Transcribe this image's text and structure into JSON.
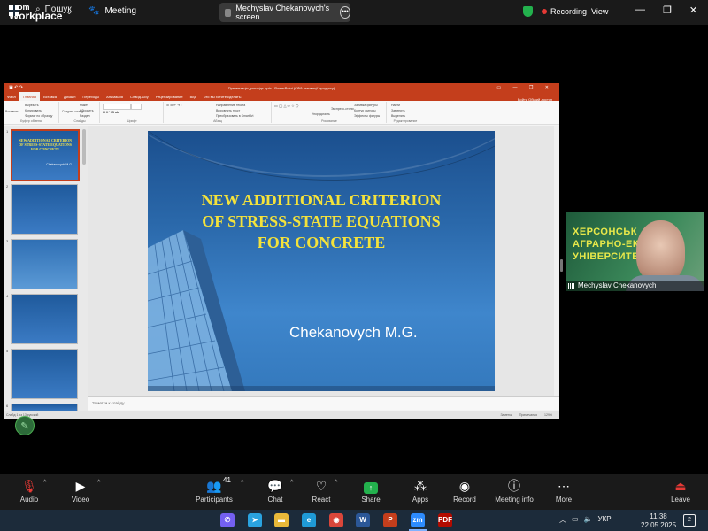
{
  "zoom": {
    "logo_line1": "zoom",
    "logo_line2": "Workplace",
    "meeting_label": "Meeting",
    "share_title": "Mechyslav Chekanovych's screen",
    "share_more": "•••",
    "recording_label": "Recording",
    "view_label": "View",
    "window_controls": [
      "—",
      "❐",
      "✕"
    ],
    "accent": "#23b14d"
  },
  "ppt": {
    "title": "Презентація доповідь.pptx - PowerPoint (Сбій активації продукту)",
    "window_controls": [
      "▭",
      "—",
      "❐",
      "✕"
    ],
    "tabs": [
      "Файл",
      "Главная",
      "Вставка",
      "Дизайн",
      "Переходы",
      "Анимация",
      "Слайд-шоу",
      "Рецензирование",
      "Вид",
      "Что вы хотите сделать?"
    ],
    "tab_right": "Войти   Общий доступ",
    "ribbon": {
      "clipboard": [
        "Вставить",
        "Вырезать",
        "Копировать",
        "Формат по образцу"
      ],
      "clipboard_cap": "Буфер обмена",
      "slides": [
        "Создать слайд",
        "Макет",
        "Сбросить",
        "Раздел"
      ],
      "slides_cap": "Слайды",
      "font_cap": "Шрифт",
      "paragraph": [
        "Направление текста",
        "Выровнять текст",
        "Преобразовать в SmartArt"
      ],
      "paragraph_cap": "Абзац",
      "drawing": [
        "Упорядочить",
        "Экспресс-стили",
        "Заливка фигуры",
        "Контур фигуры",
        "Эффекты фигуры"
      ],
      "drawing_cap": "Рисование",
      "editing": [
        "Найти",
        "Заменить",
        "Выделить"
      ],
      "editing_cap": "Редактирование"
    },
    "thumbnails": [
      {
        "num": "1",
        "title": "NEW ADDITIONAL CRITERION OF STRESS-STATE EQUATIONS FOR CONCRETE",
        "author": "Chekanovych M.G."
      },
      {
        "num": "2"
      },
      {
        "num": "3"
      },
      {
        "num": "4"
      },
      {
        "num": "5"
      },
      {
        "num": "6"
      }
    ],
    "notes_placeholder": "Заметки к слайду",
    "status_left": "Слайд 1 из 13   русский",
    "status_right": [
      "Заметки",
      "Примечания",
      "129%"
    ]
  },
  "slide": {
    "title_lines": [
      "NEW ADDITIONAL CRITERION",
      "OF STRESS-STATE EQUATIONS",
      "FOR CONCRETE"
    ],
    "author": "Chekanovych M.G.",
    "title_color": "#f4e23b"
  },
  "video": {
    "banner_lines": [
      "ХЕРСОНСЬК",
      "АГРАРНО-ЕКО",
      "УНІВЕРСИТЕТ"
    ],
    "participant_name": "Mechyslav Chekanovych"
  },
  "toolbar": {
    "audio": "Audio",
    "video": "Video",
    "participants": "Participants",
    "participants_count": "41",
    "chat": "Chat",
    "react": "React",
    "share": "Share",
    "apps": "Apps",
    "record": "Record",
    "meeting_info": "Meeting info",
    "more": "More",
    "leave": "Leave"
  },
  "taskbar": {
    "search": "Пошук",
    "apps": [
      "Viber",
      "Telegram",
      "Explorer",
      "Edge",
      "Chrome",
      "Word",
      "PowerPoint",
      "Zoom",
      "PDF"
    ],
    "lang": "УКР",
    "time": "11:38",
    "date": "22.05.2025",
    "notifications": "2"
  }
}
